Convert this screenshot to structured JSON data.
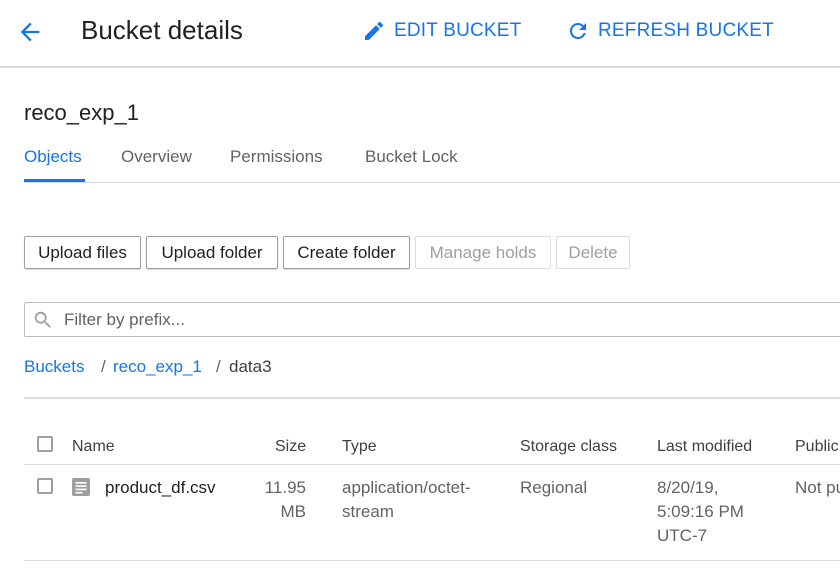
{
  "header": {
    "title": "Bucket details",
    "edit_label": "EDIT BUCKET",
    "refresh_label": "REFRESH BUCKET"
  },
  "bucket": {
    "name": "reco_exp_1"
  },
  "tabs": [
    {
      "label": "Objects",
      "active": true
    },
    {
      "label": "Overview"
    },
    {
      "label": "Permissions"
    },
    {
      "label": "Bucket Lock"
    }
  ],
  "toolbar": {
    "upload_files": "Upload files",
    "upload_folder": "Upload folder",
    "create_folder": "Create folder",
    "manage_holds": "Manage holds",
    "delete": "Delete"
  },
  "filter": {
    "placeholder": "Filter by prefix..."
  },
  "breadcrumb": {
    "root": "Buckets",
    "sep1": "/",
    "bucket": "reco_exp_1",
    "sep2": "/",
    "current": "data3"
  },
  "table": {
    "columns": {
      "name": "Name",
      "size": "Size",
      "type": "Type",
      "storage_class": "Storage class",
      "last_modified": "Last modified",
      "public": "Public"
    },
    "rows": [
      {
        "name": "product_df.csv",
        "size_line1": "11.95",
        "size_line2": "MB",
        "type_line1": "application/octet-",
        "type_line2": "stream",
        "storage_class": "Regional",
        "modified_line1": "8/20/19,",
        "modified_line2": "5:09:16 PM",
        "modified_line3": "UTC-7",
        "public": "Not public"
      }
    ]
  },
  "colors": {
    "accent": "#1a73e8",
    "text": "#202124",
    "muted": "#5f6368",
    "border": "#dadce0"
  }
}
